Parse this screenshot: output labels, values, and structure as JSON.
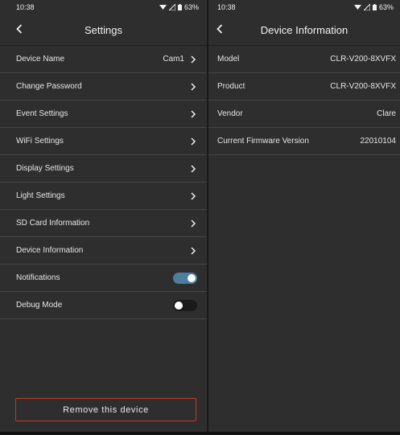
{
  "left": {
    "status": {
      "time": "10:38",
      "battery": "63%"
    },
    "title": "Settings",
    "rows": [
      {
        "label": "Device Name",
        "value": "Cam1"
      },
      {
        "label": "Change Password",
        "value": ""
      },
      {
        "label": "Event Settings",
        "value": ""
      },
      {
        "label": "WiFi Settings",
        "value": ""
      },
      {
        "label": "Display Settings",
        "value": ""
      },
      {
        "label": "Light Settings",
        "value": ""
      },
      {
        "label": "SD Card Information",
        "value": ""
      },
      {
        "label": "Device Information",
        "value": ""
      }
    ],
    "toggles": [
      {
        "label": "Notifications",
        "on": true
      },
      {
        "label": "Debug Mode",
        "on": false
      }
    ],
    "remove_label": "Remove this device"
  },
  "right": {
    "status": {
      "time": "10:38",
      "battery": "63%"
    },
    "title": "Device Information",
    "rows": [
      {
        "label": "Model",
        "value": "CLR-V200-8XVFX"
      },
      {
        "label": "Product",
        "value": "CLR-V200-8XVFX"
      },
      {
        "label": "Vendor",
        "value": "Clare"
      },
      {
        "label": "Current Firmware Version",
        "value": "22010104"
      }
    ]
  },
  "colors": {
    "toggle_on": "#4a7fa0",
    "toggle_off": "#1a1a1a",
    "remove_border": "#c0392b"
  }
}
